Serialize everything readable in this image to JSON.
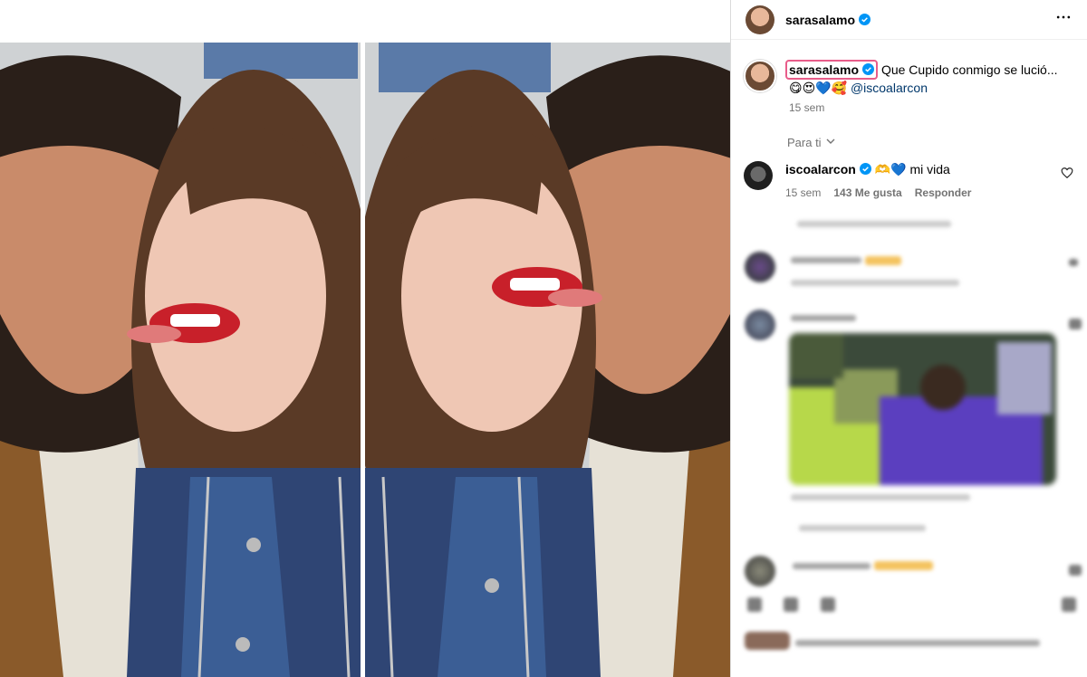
{
  "post": {
    "author": "sarasalamo",
    "caption_text": "Que Cupido conmigo se lució...",
    "caption_emojis": "😋😍💙🥰",
    "caption_mention": "@iscoalarcon",
    "caption_age": "15 sem"
  },
  "comments_filter": {
    "label": "Para ti"
  },
  "comments": [
    {
      "username": "iscoalarcon",
      "emojis": "🫶💙",
      "text": "mi vida",
      "age": "15 sem",
      "likes": "143 Me gusta",
      "reply_label": "Responder"
    }
  ],
  "icons": {
    "verified": "verified-badge-icon",
    "more": "more-options-icon",
    "heart": "heart-icon",
    "chevron": "chevron-down-icon"
  },
  "colors": {
    "verified_blue": "#0095f6",
    "mention_blue": "#00376b",
    "secondary_text": "#737373",
    "highlight_pink": "#e85d8a"
  }
}
